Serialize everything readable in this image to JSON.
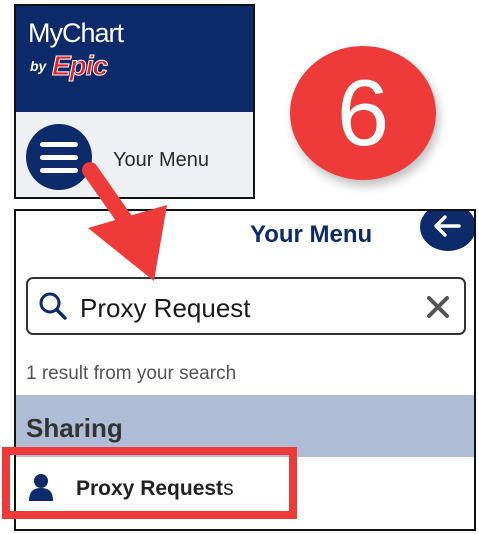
{
  "brand": {
    "wordmark": "MyChart",
    "by": "by",
    "vendor": "Epic",
    "bar_color": "#0d2a6b",
    "vendor_color": "#e31f26"
  },
  "top_menu": {
    "icon": "hamburger-menu-icon",
    "label": "Your Menu"
  },
  "step_badge": {
    "number": "6",
    "color": "#ee3b39"
  },
  "menu_panel": {
    "title": "Your Menu",
    "back_icon": "arrow-left-icon",
    "search": {
      "icon": "search-icon",
      "value": "Proxy Request",
      "clear_icon": "close-icon"
    },
    "result_count": "1 result from your search",
    "section": {
      "label": "Sharing",
      "band_color": "#aebcd6"
    },
    "results": [
      {
        "icon": "person-icon",
        "label_match": "Proxy Request",
        "label_rest": "s"
      }
    ]
  },
  "annotations": {
    "arrow_color": "#ee3b39",
    "highlight_color": "#ee3b39"
  }
}
